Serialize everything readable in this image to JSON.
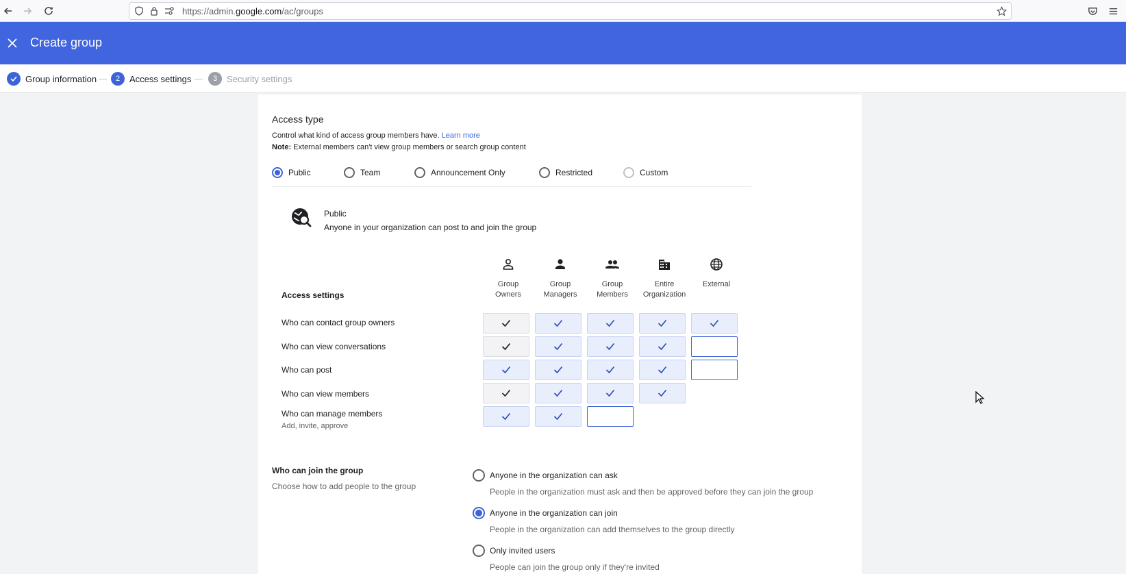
{
  "browser": {
    "url_prefix": "https://admin.",
    "url_host": "google.com",
    "url_path": "/ac/groups",
    "icons": [
      "back-arrow-icon",
      "forward-arrow-icon",
      "reload-icon",
      "shield-icon",
      "lock-icon",
      "permissions-icon",
      "star-icon",
      "pocket-icon",
      "menu-icon"
    ]
  },
  "header": {
    "title": "Create group",
    "close_icon": "close-icon",
    "color": "#4164df"
  },
  "stepper": {
    "steps": [
      {
        "label": "Group information",
        "state": "done",
        "marker": ""
      },
      {
        "label": "Access settings",
        "state": "current",
        "marker": "2"
      },
      {
        "label": "Security settings",
        "state": "todo",
        "marker": "3"
      }
    ]
  },
  "access_type": {
    "title": "Access type",
    "description": "Control what kind of access group members have.",
    "learn_more": "Learn more",
    "note_label": "Note:",
    "note_text": "External members can't view group members or search group content",
    "options": [
      {
        "label": "Public",
        "selected": true
      },
      {
        "label": "Team",
        "selected": false
      },
      {
        "label": "Announcement Only",
        "selected": false
      },
      {
        "label": "Restricted",
        "selected": false
      },
      {
        "label": "Custom",
        "selected": false
      }
    ],
    "summary_title": "Public",
    "summary_desc": "Anyone in your organization can post to and join the group"
  },
  "access_settings": {
    "label": "Access settings",
    "columns": [
      {
        "line1": "Group",
        "line2": "Owners",
        "icon": "person-outline-icon"
      },
      {
        "line1": "Group",
        "line2": "Managers",
        "icon": "person-icon"
      },
      {
        "line1": "Group",
        "line2": "Members",
        "icon": "people-icon"
      },
      {
        "line1": "Entire",
        "line2": "Organization",
        "icon": "building-icon"
      },
      {
        "line1": "External",
        "line2": "",
        "icon": "globe-icon"
      }
    ],
    "rows": [
      {
        "label": "Who can contact group owners",
        "sub": "",
        "cells": [
          "fixed",
          "checked",
          "checked",
          "checked",
          "checked"
        ]
      },
      {
        "label": "Who can view conversations",
        "sub": "",
        "cells": [
          "fixed",
          "checked",
          "checked",
          "checked",
          "empty"
        ]
      },
      {
        "label": "Who can post",
        "sub": "",
        "cells": [
          "checked",
          "checked",
          "checked",
          "checked",
          "empty"
        ]
      },
      {
        "label": "Who can view members",
        "sub": "",
        "cells": [
          "fixed",
          "checked",
          "checked",
          "checked",
          "none"
        ]
      },
      {
        "label": "Who can manage members",
        "sub": "Add, invite, approve",
        "cells": [
          "checked",
          "checked",
          "empty",
          "none",
          "none"
        ]
      }
    ]
  },
  "join": {
    "title": "Who can join the group",
    "description": "Choose how to add people to the group",
    "options": [
      {
        "label": "Anyone in the organization can ask",
        "help": "People in the organization must ask and then be approved before they can join the group",
        "selected": false
      },
      {
        "label": "Anyone in the organization can join",
        "help": "People in the organization can add themselves to the group directly",
        "selected": true
      },
      {
        "label": "Only invited users",
        "help": "People can join the group only if they're invited",
        "selected": false
      }
    ]
  }
}
